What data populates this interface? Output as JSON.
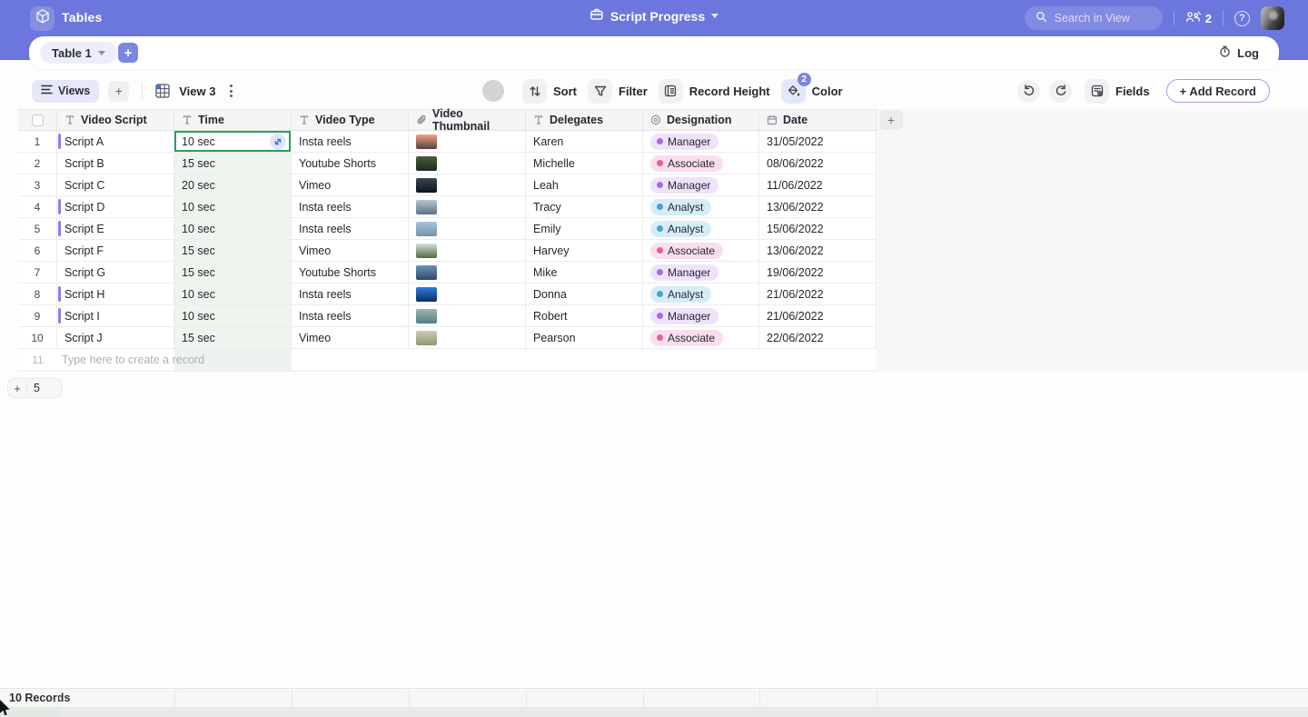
{
  "colors": {
    "accent": "#6b77dc",
    "selected_cell_border": "#2aa158",
    "time_cell_bg": "#edf5ee",
    "new_row_time_bg": "#ecf2ee",
    "row_marker": "#8b7cf0",
    "designation": {
      "Manager": {
        "bg": "#efe2fb",
        "dot": "#a36de6"
      },
      "Associate": {
        "bg": "#fbdeeb",
        "dot": "#e75f95"
      },
      "Analyst": {
        "bg": "#d7ecf9",
        "dot": "#3ea4da"
      }
    }
  },
  "header": {
    "app_name": "Tables",
    "base_title": "Script Progress",
    "search_placeholder": "Search in View",
    "collaborator_count": "2",
    "help_label": "?"
  },
  "tab_bar": {
    "table_tab_label": "Table 1",
    "add_table_label": "+",
    "log_label": "Log"
  },
  "toolbar": {
    "views_label": "Views",
    "add_view_label": "+",
    "view_name": "View 3",
    "sort_label": "Sort",
    "filter_label": "Filter",
    "record_height_label": "Record Height",
    "color_label": "Color",
    "color_badge_count": "2",
    "fields_label": "Fields",
    "add_record_label": "+ Add Record"
  },
  "table": {
    "columns": [
      {
        "label": "Video Script",
        "type": "text"
      },
      {
        "label": "Time",
        "type": "text"
      },
      {
        "label": "Video Type",
        "type": "text"
      },
      {
        "label": "Video Thumbnail",
        "type": "attachment"
      },
      {
        "label": "Delegates",
        "type": "text"
      },
      {
        "label": "Designation",
        "type": "select"
      },
      {
        "label": "Date",
        "type": "date"
      }
    ],
    "rows": [
      {
        "num": "1",
        "script": "Script A",
        "time": "10 sec",
        "video_type": "Insta reels",
        "delegate": "Karen",
        "designation": "Manager",
        "date": "31/05/2022",
        "marked": true,
        "selected": true,
        "thumb": [
          "#efa184",
          "#56423f"
        ]
      },
      {
        "num": "2",
        "script": "Script B",
        "time": "15 sec",
        "video_type": "Youtube Shorts",
        "delegate": "Michelle",
        "designation": "Associate",
        "date": "08/06/2022",
        "marked": false,
        "selected": false,
        "thumb": [
          "#47603b",
          "#1d2a1c"
        ]
      },
      {
        "num": "3",
        "script": "Script C",
        "time": "20 sec",
        "video_type": "Vimeo",
        "delegate": "Leah",
        "designation": "Manager",
        "date": "11/06/2022",
        "marked": false,
        "selected": false,
        "thumb": [
          "#3c4656",
          "#10131d"
        ]
      },
      {
        "num": "4",
        "script": "Script D",
        "time": "10 sec",
        "video_type": "Insta reels",
        "delegate": "Tracy",
        "designation": "Analyst",
        "date": "13/06/2022",
        "marked": true,
        "selected": false,
        "thumb": [
          "#b8c5cf",
          "#5d7186"
        ]
      },
      {
        "num": "5",
        "script": "Script E",
        "time": "10 sec",
        "video_type": "Insta reels",
        "delegate": "Emily",
        "designation": "Analyst",
        "date": "15/06/2022",
        "marked": true,
        "selected": false,
        "thumb": [
          "#a9c3d6",
          "#7193ad"
        ]
      },
      {
        "num": "6",
        "script": "Script F",
        "time": "15 sec",
        "video_type": "Vimeo",
        "delegate": "Harvey",
        "designation": "Associate",
        "date": "13/06/2022",
        "marked": false,
        "selected": false,
        "thumb": [
          "#d8dfd9",
          "#4f6b43"
        ]
      },
      {
        "num": "7",
        "script": "Script G",
        "time": "15 sec",
        "video_type": "Youtube Shorts",
        "delegate": "Mike",
        "designation": "Manager",
        "date": "19/06/2022",
        "marked": false,
        "selected": false,
        "thumb": [
          "#6e93b8",
          "#2b4a66"
        ]
      },
      {
        "num": "8",
        "script": "Script H",
        "time": "10 sec",
        "video_type": "Insta reels",
        "delegate": "Donna",
        "designation": "Analyst",
        "date": "21/06/2022",
        "marked": true,
        "selected": false,
        "thumb": [
          "#2f7bdc",
          "#0c2f63"
        ]
      },
      {
        "num": "9",
        "script": "Script I",
        "time": "10 sec",
        "video_type": "Insta reels",
        "delegate": "Robert",
        "designation": "Manager",
        "date": "21/06/2022",
        "marked": true,
        "selected": false,
        "thumb": [
          "#9db8a8",
          "#567d86"
        ]
      },
      {
        "num": "10",
        "script": "Script J",
        "time": "15 sec",
        "video_type": "Vimeo",
        "delegate": "Pearson",
        "designation": "Associate",
        "date": "22/06/2022",
        "marked": false,
        "selected": false,
        "thumb": [
          "#cfcbb4",
          "#8d9a73"
        ]
      }
    ],
    "new_row": {
      "num": "11",
      "placeholder": "Type here to create a record"
    },
    "add_rows_count": "5",
    "add_field_label": "+"
  },
  "footer": {
    "record_count": "10 Records"
  }
}
